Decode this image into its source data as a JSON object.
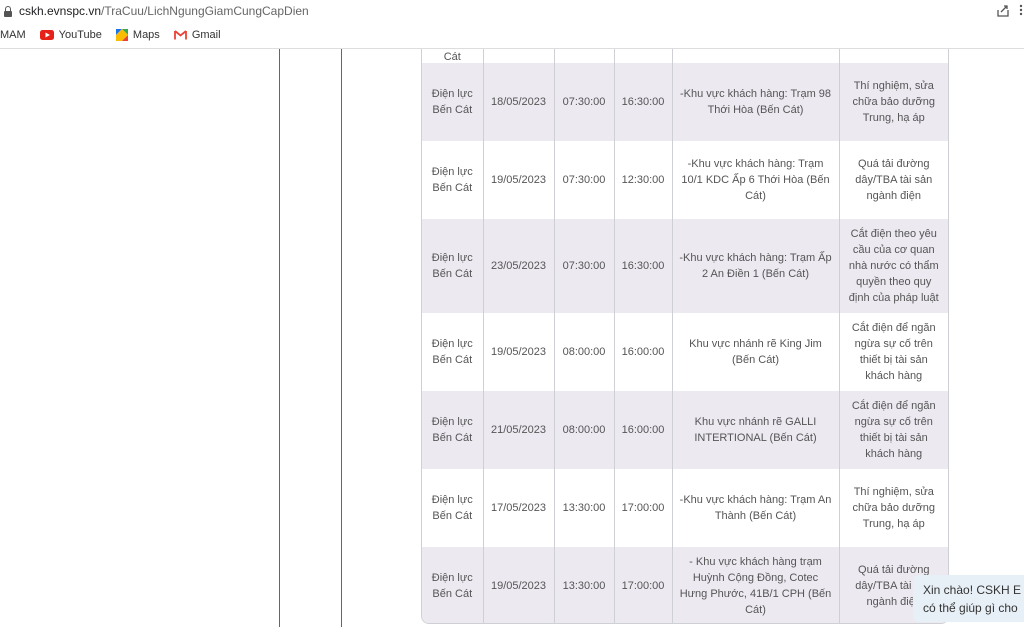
{
  "browser": {
    "url_domain": "cskh.evnspc.vn",
    "url_path": "/TraCuu/LichNgungGiamCungCapDien",
    "bookmarks": [
      "MAM",
      "YouTube",
      "Maps",
      "Gmail"
    ]
  },
  "table": {
    "top_partial": "Cát",
    "rows": [
      {
        "unit": "Điện lực Bến Cát",
        "date": "18/05/2023",
        "start": "07:30:00",
        "end": "16:30:00",
        "area": "-Khu vực khách hàng: Trạm 98 Thới Hòa (Bến Cát)",
        "reason": "Thí nghiệm, sửa chữa bảo dưỡng Trung, hạ áp"
      },
      {
        "unit": "Điện lực Bến Cát",
        "date": "19/05/2023",
        "start": "07:30:00",
        "end": "12:30:00",
        "area": "-Khu vực khách hàng: Trạm 10/1 KDC Ấp 6 Thới Hòa (Bến Cát)",
        "reason": "Quá tải đường dây/TBA tài sản ngành điện"
      },
      {
        "unit": "Điện lực Bến Cát",
        "date": "23/05/2023",
        "start": "07:30:00",
        "end": "16:30:00",
        "area": "-Khu vực khách hàng: Trạm Ấp 2 An Điền 1 (Bến Cát)",
        "reason": "Cắt điện theo yêu cầu của cơ quan nhà nước có thẩm quyền theo quy định của pháp luật"
      },
      {
        "unit": "Điện lực Bến Cát",
        "date": "19/05/2023",
        "start": "08:00:00",
        "end": "16:00:00",
        "area": "Khu vực nhánh rẽ King Jim (Bến Cát)",
        "reason": "Cắt điện để ngăn ngừa sự cố trên thiết bị tài sản khách hàng"
      },
      {
        "unit": "Điện lực Bến Cát",
        "date": "21/05/2023",
        "start": "08:00:00",
        "end": "16:00:00",
        "area": "Khu vực nhánh rẽ GALLI INTERTIONAL (Bến Cát)",
        "reason": "Cắt điện để ngăn ngừa sự cố trên thiết bị tài sản khách hàng"
      },
      {
        "unit": "Điện lực Bến Cát",
        "date": "17/05/2023",
        "start": "13:30:00",
        "end": "17:00:00",
        "area": "-Khu vực khách hàng: Trạm An Thành (Bến Cát)",
        "reason": "Thí nghiệm, sửa chữa bảo dưỡng Trung, hạ áp"
      },
      {
        "unit": "Điện lực Bến Cát",
        "date": "19/05/2023",
        "start": "13:30:00",
        "end": "17:00:00",
        "area": "- Khu vực khách hàng trạm Huỳnh Cộng Đồng, Cotec Hưng Phước, 41B/1 CPH (Bến Cát)",
        "reason": "Quá tải đường dây/TBA tài sản ngành điện"
      }
    ]
  },
  "chat": {
    "line1": "Xin chào! CSKH E",
    "line2": "có thể giúp gì cho"
  }
}
